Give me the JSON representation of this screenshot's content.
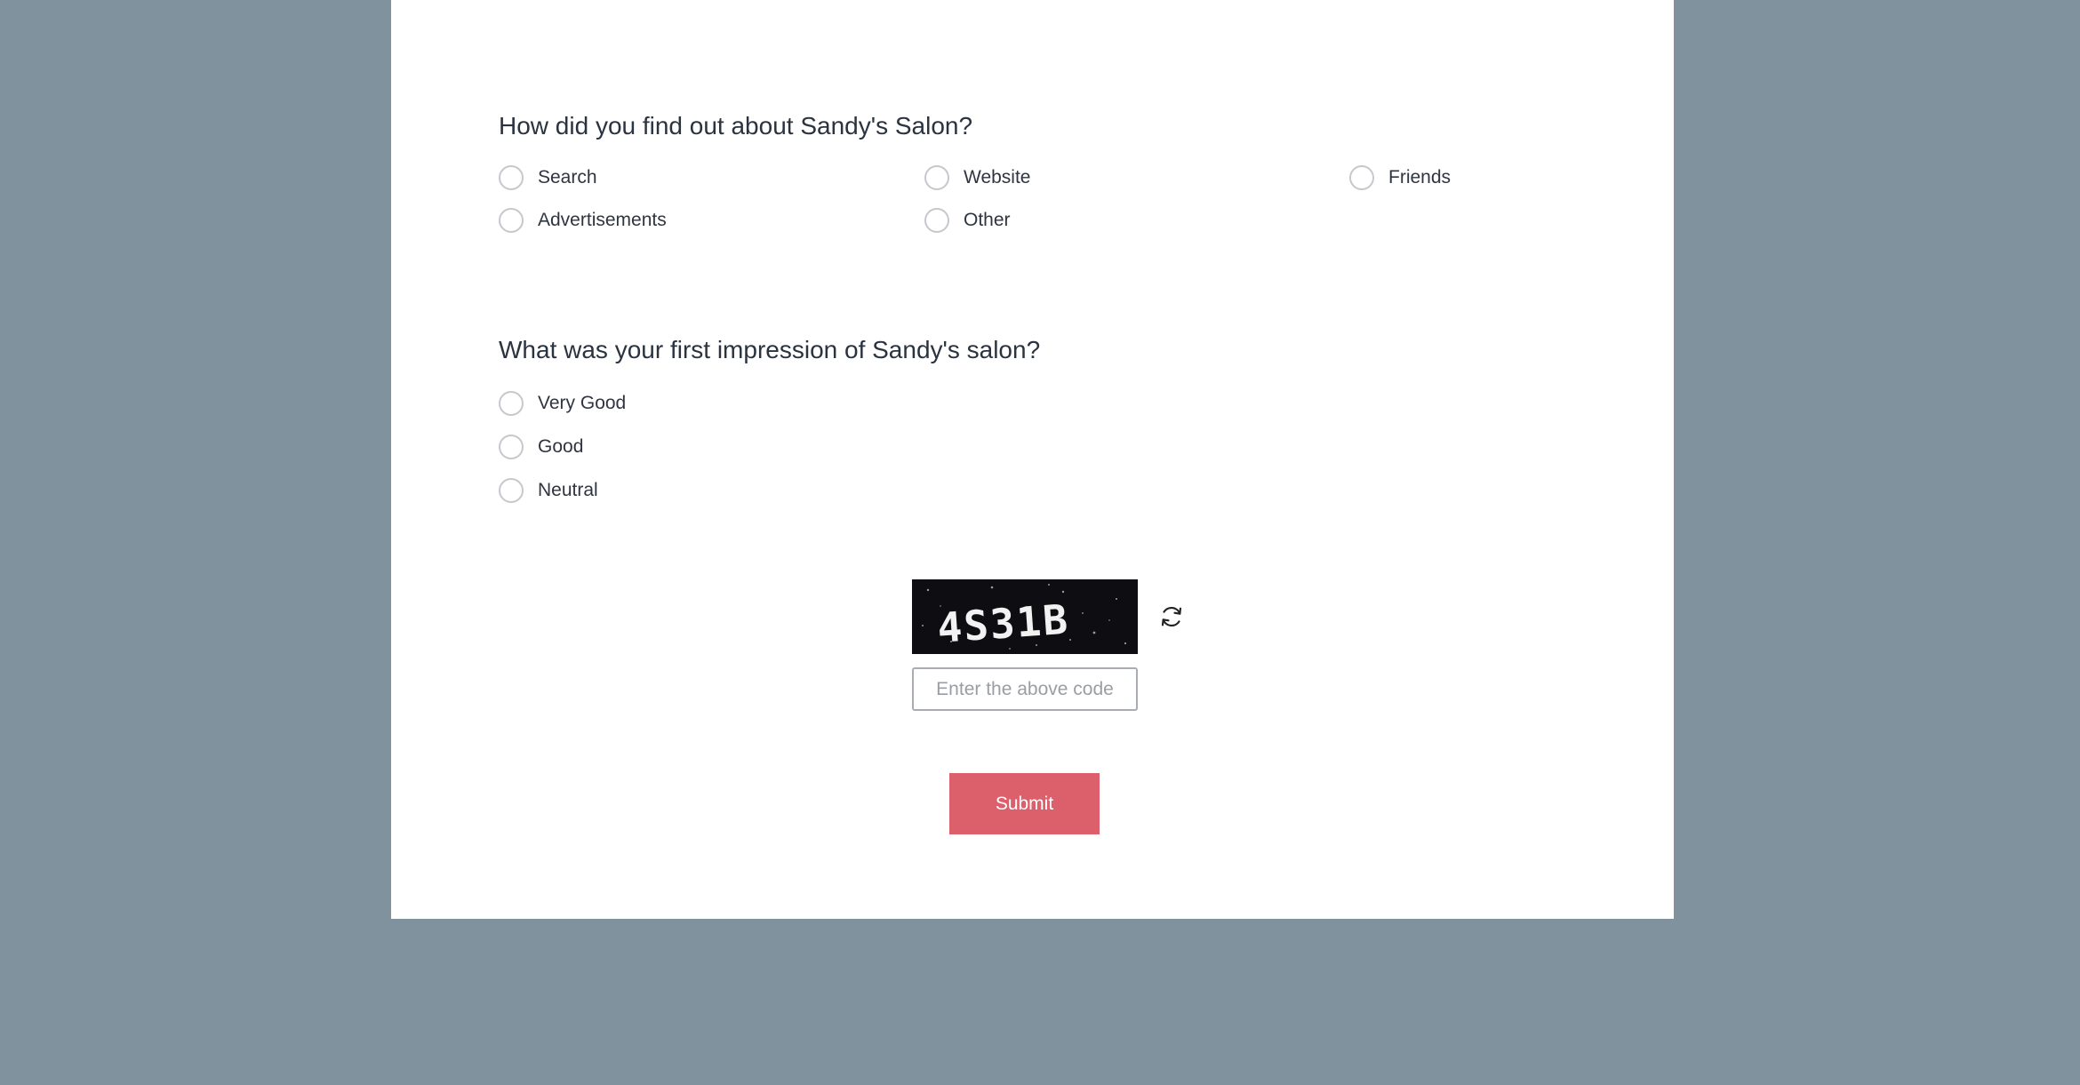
{
  "survey": {
    "q1": {
      "label": "How did you find out about Sandy's Salon?",
      "options": [
        "Search",
        "Website",
        "Friends",
        "Advertisements",
        "Other"
      ]
    },
    "q2": {
      "label": "What was your first impression of Sandy's salon?",
      "options": [
        "Very Good",
        "Good",
        "Neutral"
      ]
    }
  },
  "captcha": {
    "code": "4S31B",
    "refresh_icon": "refresh-icon",
    "input_placeholder": "Enter the above code"
  },
  "submit_label": "Submit",
  "colors": {
    "background": "#7f929d",
    "card": "#ffffff",
    "submit": "#dc5f6c",
    "captcha_bg": "#0e0e12"
  }
}
